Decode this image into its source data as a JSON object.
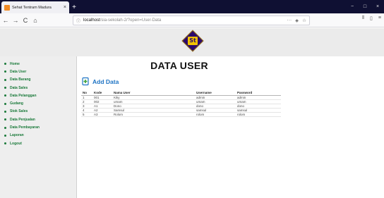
{
  "browser": {
    "tab_title": "Sehat Tentram Madura",
    "tab_close": "×",
    "new_tab": "+",
    "win_min": "−",
    "win_max": "□",
    "win_close": "×",
    "url_host": "localhost",
    "url_path": "/sia-sekolah-2/?open=User-Data",
    "url_more": "···",
    "back": "←",
    "forward": "→",
    "reload": "C",
    "home": "⌂"
  },
  "header": {
    "logo_text": "St"
  },
  "sidebar": {
    "items": [
      {
        "label": "Home"
      },
      {
        "label": "Data User"
      },
      {
        "label": "Data Barang"
      },
      {
        "label": "Data Sales"
      },
      {
        "label": "Data Pelanggan"
      },
      {
        "label": "Gudang"
      },
      {
        "label": "Stok Sales"
      },
      {
        "label": "Data Penjualan"
      },
      {
        "label": "Data Pembayaran"
      },
      {
        "label": "Laporan"
      },
      {
        "label": "Logout"
      }
    ]
  },
  "main": {
    "title": "DATA USER",
    "add_label": "Add Data",
    "table": {
      "headers": [
        "No",
        "Kode",
        "Nama User",
        "Username",
        "Password"
      ],
      "rows": [
        [
          "1",
          "001",
          "Kiky",
          "admin",
          "admin"
        ],
        [
          "2",
          "002",
          "umam",
          "umam",
          "umam"
        ],
        [
          "3",
          "A1",
          "Dono",
          "dono",
          "dono"
        ],
        [
          "4",
          "A2",
          "Samsul",
          "samsul",
          "samsul"
        ],
        [
          "5",
          "A3",
          "Rolom",
          "rolom",
          "rolom"
        ]
      ]
    }
  },
  "colors": {
    "accent_green": "#1a7a3a",
    "accent_blue": "#1f74c4",
    "tabbar": "#0f1033"
  }
}
